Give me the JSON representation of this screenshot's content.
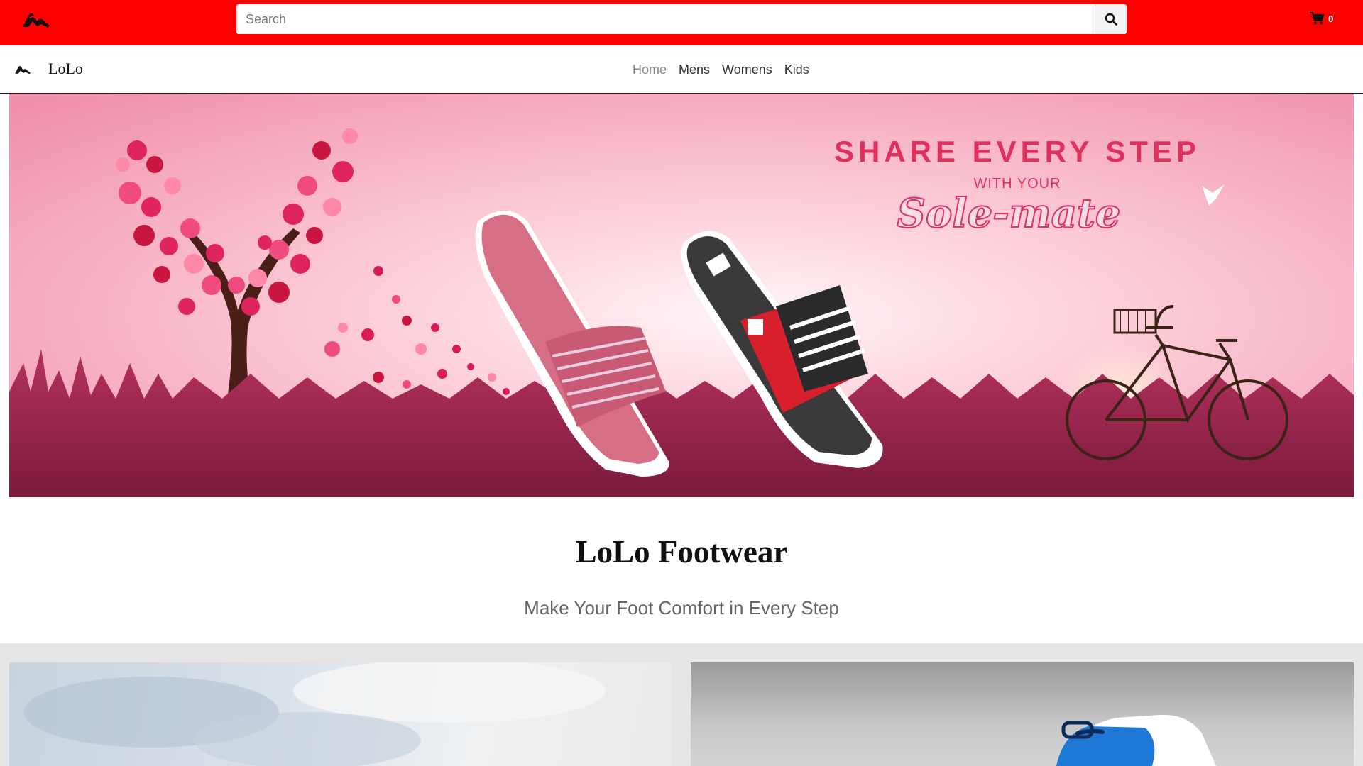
{
  "header": {
    "search": {
      "placeholder": "Search",
      "value": ""
    },
    "cart": {
      "count": "0"
    }
  },
  "navbar": {
    "brand": "LoLo",
    "links": [
      {
        "label": "Home",
        "active": true
      },
      {
        "label": "Mens",
        "active": false
      },
      {
        "label": "Womens",
        "active": false
      },
      {
        "label": "Kids",
        "active": false
      }
    ]
  },
  "hero": {
    "headline": "SHARE EVERY STEP",
    "subline": "WITH YOUR",
    "script": "Sole-mate"
  },
  "intro": {
    "title": "LoLo Footwear",
    "subtitle": "Make Your Foot Comfort in Every Step"
  },
  "colors": {
    "topbar": "#ff0000",
    "hero_text": "#e0305e",
    "grass": "#8e1e48"
  },
  "icons": [
    "logo-icon",
    "search-icon",
    "cart-icon"
  ]
}
